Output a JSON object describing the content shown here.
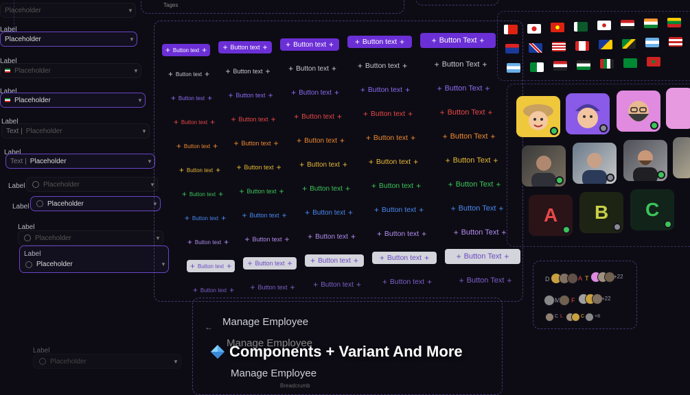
{
  "fields": {
    "label": "Label",
    "placeholder": "Placeholder",
    "prefix": "Text |",
    "top_tags": "Tages"
  },
  "buttons": {
    "small": "Button text",
    "large": "Button Text"
  },
  "avatars": {
    "letters": [
      "A",
      "B",
      "C"
    ]
  },
  "stacks": {
    "row1": {
      "l1": "D",
      "l2": "A",
      "l3": "T",
      "count": "+22"
    },
    "row2": {
      "l1": "M",
      "l2": "F",
      "count": "+22"
    },
    "row3": {
      "l1": "C",
      "l2": "L",
      "l3": "C",
      "count": "+8"
    }
  },
  "manage": {
    "title": "Manage Employee",
    "breadcrumb": "Breadcrumb"
  },
  "caption": "Components + Variant And More",
  "colors": {
    "accent": "#6b2fd6",
    "background": "#0d0c14",
    "status_online": "#3cc45a",
    "status_away": "#8a8a96"
  }
}
